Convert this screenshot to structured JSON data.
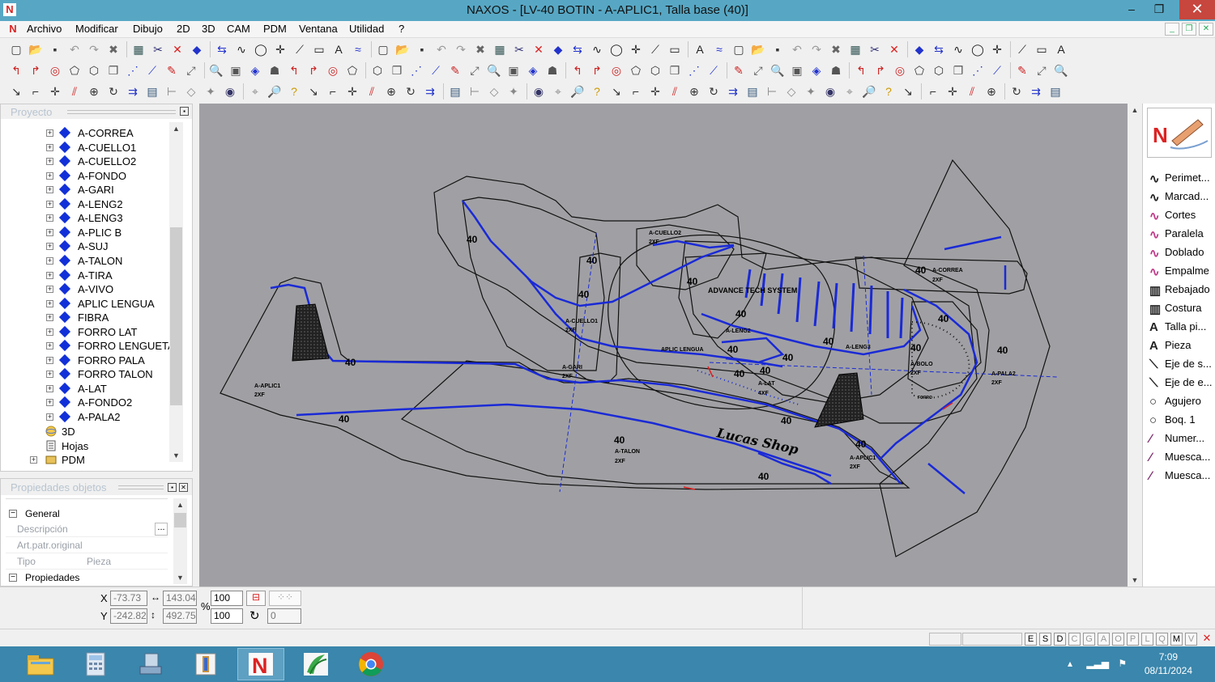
{
  "window": {
    "title": "NAXOS - [LV-40 BOTIN - A-APLIC1, Talla base (40)]",
    "app_icon_letter": "N",
    "min": "–",
    "max": "❐",
    "close": "✕"
  },
  "menu": {
    "items": [
      "Archivo",
      "Modificar",
      "Dibujo",
      "2D",
      "3D",
      "CAM",
      "PDM",
      "Ventana",
      "Utilidad",
      "?"
    ]
  },
  "project_panel": {
    "title": "Proyecto",
    "items": [
      "A-CORREA",
      "A-CUELLO1",
      "A-CUELLO2",
      "A-FONDO",
      "A-GARI",
      "A-LENG2",
      "A-LENG3",
      "A-PLIC B",
      "A-SUJ",
      "A-TALON",
      "A-TIRA",
      "A-VIVO",
      "APLIC LENGUA",
      "FIBRA",
      "FORRO LAT",
      "FORRO LENGUETA",
      "FORRO PALA",
      "FORRO TALON",
      "A-LAT",
      "A-FONDO2",
      "A-PALA2"
    ],
    "nodes": [
      "3D",
      "Hojas",
      "PDM"
    ]
  },
  "properties_panel": {
    "title": "Propiedades objetos",
    "group_general": "General",
    "rows": [
      {
        "key": "Descripción",
        "value": "",
        "more": "..."
      },
      {
        "key": "Art.patr.original",
        "value": ""
      },
      {
        "key": "Tipo",
        "value": "Pieza"
      }
    ],
    "group_props": "Propiedades"
  },
  "drawing": {
    "size_labels": [
      "40",
      "40",
      "40",
      "40",
      "40",
      "40",
      "40",
      "40",
      "40",
      "40",
      "40",
      "40",
      "40",
      "40",
      "40",
      "40",
      "40",
      "40",
      "40",
      "40"
    ],
    "piece_labels": {
      "aplic1_left": "A-APLIC1",
      "aplic1_left_qty": "2XF",
      "cuello2": "A-CUELLO2",
      "cuello2_qty": "2XF",
      "cuello1": "A-CUELLO1",
      "cuello1_qty": "2XF",
      "gari": "A-GARI",
      "gari_qty": "2XF",
      "correa": "A-CORREA",
      "correa_qty": "2XF",
      "aplic_lengua": "APLIC LENGUA",
      "leng2": "A-LENG2",
      "leng3": "A-LENG3",
      "lat": "A-LAT",
      "lat_qty": "4XF",
      "bolo": "A-BOLO",
      "bolo_qty": "2XF",
      "pala2": "A-PALA2",
      "pala2_qty": "2XF",
      "talon": "A-TALON",
      "talon_qty": "2XF",
      "aplic1_right": "A-APLIC1",
      "aplic1_right_qty": "2XF",
      "brand": "ADVANCE TECH SYSTEM",
      "script_logo": "Lucas Shop",
      "small_label": "FORRO"
    }
  },
  "right_panel": {
    "items": [
      "Perimet...",
      "Marcad...",
      "Cortes",
      "Paralela",
      "Doblado",
      "Empalme",
      "Rebajado",
      "Costura",
      "Talla pi...",
      "Pieza",
      "Eje de s...",
      "Eje de e...",
      "Agujero",
      "Boq. 1",
      "Numer...",
      "Muesca...",
      "Muesca..."
    ]
  },
  "inputbar": {
    "x_label": "X",
    "y_label": "Y",
    "x_value": "-73.73",
    "y_value": "-242.82",
    "w_value": "143.04",
    "h_value": "492.75",
    "pct": "%",
    "scale_x": "100",
    "scale_y": "100",
    "angle": "0"
  },
  "statusbar": {
    "flags": [
      "E",
      "S",
      "D",
      "C",
      "G",
      "A",
      "O",
      "P",
      "L",
      "Q",
      "M",
      "V"
    ],
    "active_flags": [
      "E",
      "S",
      "D",
      "M"
    ]
  },
  "taskbar": {
    "time": "7:09",
    "date": "08/11/2024",
    "naxos_letter": "N"
  },
  "colors": {
    "titlebar": "#57a7c4",
    "taskbar": "#3a86ac",
    "canvas": "#a0a0a4",
    "pattern_blue": "#1a2ad6",
    "close_btn": "#c7463d"
  }
}
